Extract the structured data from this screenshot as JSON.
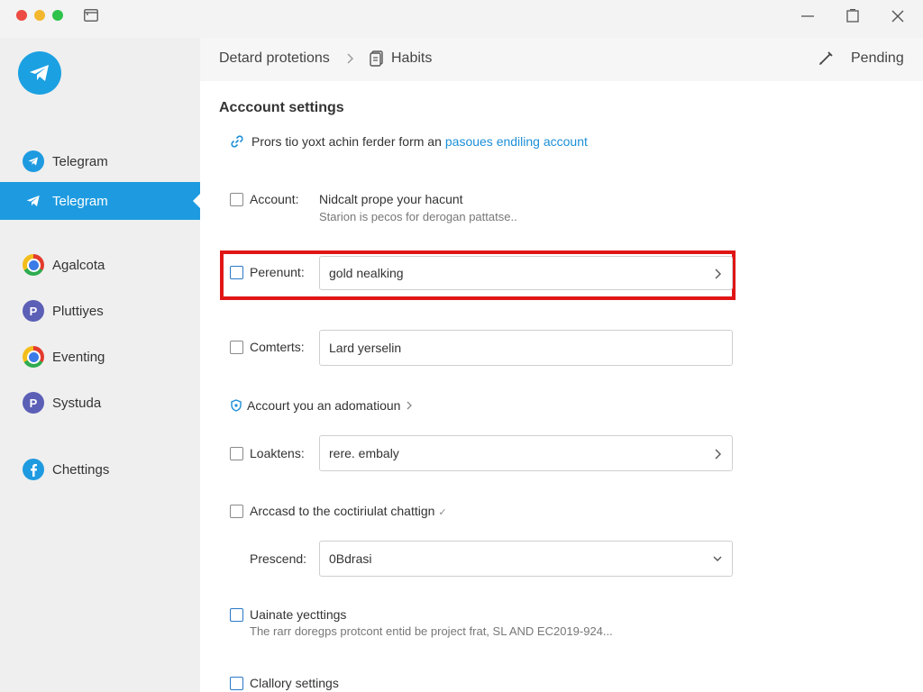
{
  "window": {
    "controls": [
      "close",
      "minimize",
      "zoom"
    ]
  },
  "sidebar": {
    "items": [
      {
        "label": "Telegram",
        "icon": "telegram-icon",
        "active": false
      },
      {
        "label": "Telegram",
        "icon": "telegram-icon",
        "active": true
      },
      {
        "label": "Agalcota",
        "icon": "chrome-icon",
        "active": false
      },
      {
        "label": "Pluttiyes",
        "icon": "p-badge-icon",
        "active": false
      },
      {
        "label": "Eventing",
        "icon": "chrome-icon",
        "active": false
      },
      {
        "label": "Systuda",
        "icon": "p-badge-icon",
        "active": false
      },
      {
        "label": "Chettings",
        "icon": "facebook-icon",
        "active": false
      }
    ]
  },
  "header": {
    "breadcrumb": [
      "Detard protetions",
      "Habits"
    ],
    "status": "Pending"
  },
  "main": {
    "title": "Acccount settings",
    "promo_text": "Prors tio yoxt achin ferder form an",
    "promo_link": "pasoues endiling account",
    "rows": {
      "account": {
        "label": "Account:",
        "value": "Nidcalt prope your hacunt",
        "description": "Starion is pecos for derogan pattatse.."
      },
      "perenunt": {
        "label": "Perenunt:",
        "value": "gold nealking"
      },
      "comterts": {
        "label": "Comterts:",
        "value": "Lard yerselin"
      },
      "sub_heading": "Accourt you an adomatioun",
      "loaktens": {
        "label": "Loaktens:",
        "value": "rere. embaly"
      },
      "arccasd": {
        "label": "Arccasd to the coctiriulat chattign"
      },
      "prescend": {
        "label": "Prescend:",
        "value": "0Bdrasi"
      },
      "uainate": {
        "label": "Uainate yecttings",
        "description": "The rarr doregps protcont entid be project frat, SL AND EC2019-924..."
      },
      "clallory": {
        "label": "Clallory settings"
      }
    }
  },
  "colors": {
    "accent": "#1e9be0",
    "highlight": "#e01616",
    "sidebar_bg": "#efefef"
  }
}
